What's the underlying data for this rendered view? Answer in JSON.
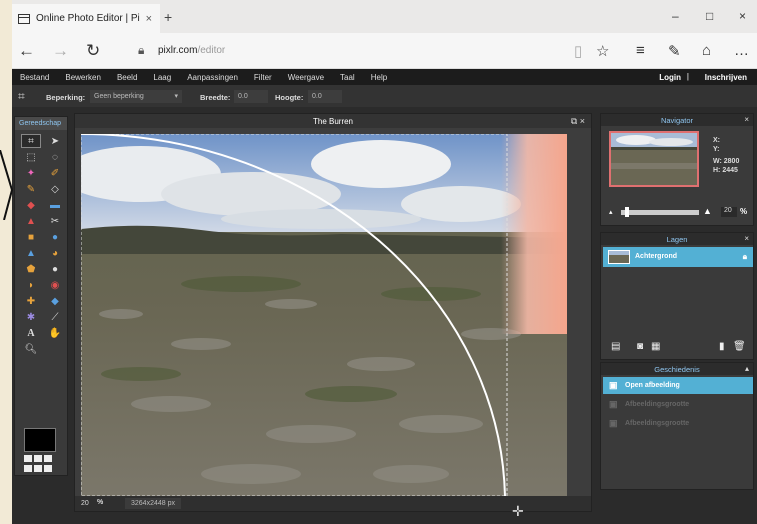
{
  "browser": {
    "tab_title": "Online Photo Editor | Pi",
    "tab_close": "×",
    "new_tab": "+",
    "url_host": "pixlr.com",
    "url_path": "/editor",
    "minimize": "–",
    "maximize": "□",
    "close": "×"
  },
  "menu": {
    "items": [
      "Bestand",
      "Bewerken",
      "Beeld",
      "Laag",
      "Aanpassingen",
      "Filter",
      "Weergave",
      "Taal",
      "Help"
    ],
    "login": "Login",
    "separator": "|",
    "signup": "Inschrijven"
  },
  "options": {
    "constraint_label": "Beperking:",
    "constraint_value": "Geen beperking",
    "width_label": "Breedte:",
    "width_value": "0.0",
    "height_label": "Hoogte:",
    "height_value": "0.0"
  },
  "toolbox": {
    "title": "Gereedschap"
  },
  "canvas": {
    "title": "The Burren",
    "zoom": "20",
    "zoom_suffix": "%",
    "dimensions": "3264x2448 px"
  },
  "navigator": {
    "title": "Navigator",
    "x_label": "X:",
    "y_label": "Y:",
    "w_label": "W:",
    "w_value": "2800",
    "h_label": "H:",
    "h_value": "2445",
    "zoom": "20",
    "zoom_suffix": "%"
  },
  "layers": {
    "title": "Lagen",
    "items": [
      {
        "name": "Achtergrond"
      }
    ]
  },
  "history": {
    "title": "Geschiedenis",
    "items": [
      {
        "label": "Open afbeelding",
        "state": "active"
      },
      {
        "label": "Afbeeldingsgrootte",
        "state": "future"
      },
      {
        "label": "Afbeeldingsgrootte",
        "state": "future"
      }
    ]
  },
  "colors": {
    "accent": "#53b0d4",
    "panel_title": "#8fc6f0"
  }
}
